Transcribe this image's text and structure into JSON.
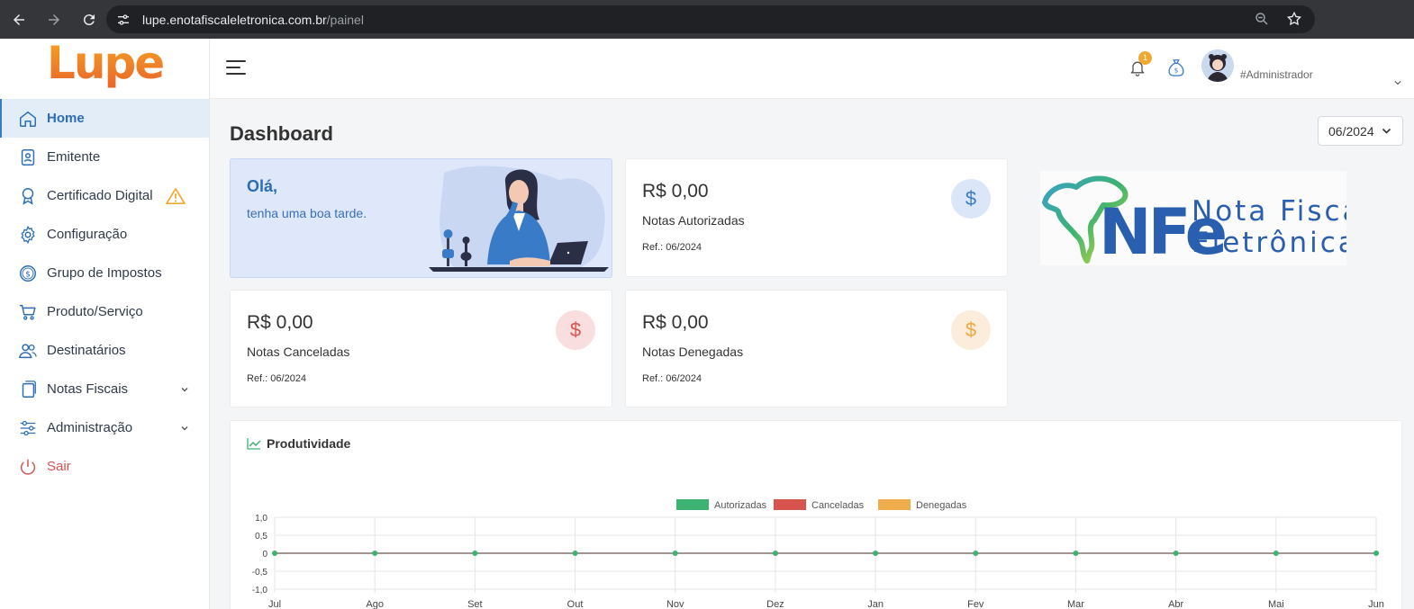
{
  "browser": {
    "url_domain": "lupe.enotafiscaleletronica.com.br",
    "url_path": "/painel"
  },
  "brand": {
    "logo_text": "Lupe"
  },
  "sidebar": {
    "items": [
      {
        "label": "Home",
        "icon": "home-icon"
      },
      {
        "label": "Emitente",
        "icon": "id-badge-icon"
      },
      {
        "label": "Certificado Digital",
        "icon": "award-icon"
      },
      {
        "label": "Configuração",
        "icon": "gear-icon"
      },
      {
        "label": "Grupo de Impostos",
        "icon": "coin-icon"
      },
      {
        "label": "Produto/Serviço",
        "icon": "cart-icon"
      },
      {
        "label": "Destinatários",
        "icon": "people-icon"
      },
      {
        "label": "Notas Fiscais",
        "icon": "copy-icon"
      },
      {
        "label": "Administração",
        "icon": "sliders-icon"
      },
      {
        "label": "Sair",
        "icon": "power-icon"
      }
    ]
  },
  "header": {
    "notification_count": "1",
    "user_name": "#Administrador"
  },
  "main": {
    "title": "Dashboard",
    "month_selected": "06/2024",
    "greeting": {
      "title": "Olá,",
      "subtitle": "tenha uma boa tarde."
    },
    "cards": [
      {
        "value": "R$ 0,00",
        "label": "Notas Autorizadas",
        "ref": "Ref.: 06/2024",
        "color": "#3a7bc8",
        "bg": "#dbe7f8"
      },
      {
        "value": "R$ 0,00",
        "label": "Notas Canceladas",
        "ref": "Ref.: 06/2024",
        "color": "#d9534f",
        "bg": "#f8dede"
      },
      {
        "value": "R$ 0,00",
        "label": "Notas Denegadas",
        "ref": "Ref.: 06/2024",
        "color": "#f0a840",
        "bg": "#fbecdb"
      }
    ],
    "nfe_logo": {
      "big": "NFe",
      "line1": "Nota Fiscal",
      "line2": "Eletrônica"
    }
  },
  "chart_data": {
    "type": "line",
    "title": "Produtividade",
    "categories": [
      "Jul",
      "Ago",
      "Set",
      "Out",
      "Nov",
      "Dez",
      "Jan",
      "Fev",
      "Mar",
      "Abr",
      "Mai",
      "Jun"
    ],
    "y_ticks": [
      "1,0",
      "0,5",
      "0",
      "-0,5",
      "-1,0"
    ],
    "ylim": [
      -1,
      1
    ],
    "legend_position": "top",
    "series": [
      {
        "name": "Autorizadas",
        "color": "#3cb371",
        "values": [
          0,
          0,
          0,
          0,
          0,
          0,
          0,
          0,
          0,
          0,
          0,
          0
        ]
      },
      {
        "name": "Canceladas",
        "color": "#d9534f",
        "values": [
          0,
          0,
          0,
          0,
          0,
          0,
          0,
          0,
          0,
          0,
          0,
          0
        ]
      },
      {
        "name": "Denegadas",
        "color": "#f0ad4e",
        "values": [
          0,
          0,
          0,
          0,
          0,
          0,
          0,
          0,
          0,
          0,
          0,
          0
        ]
      }
    ]
  }
}
